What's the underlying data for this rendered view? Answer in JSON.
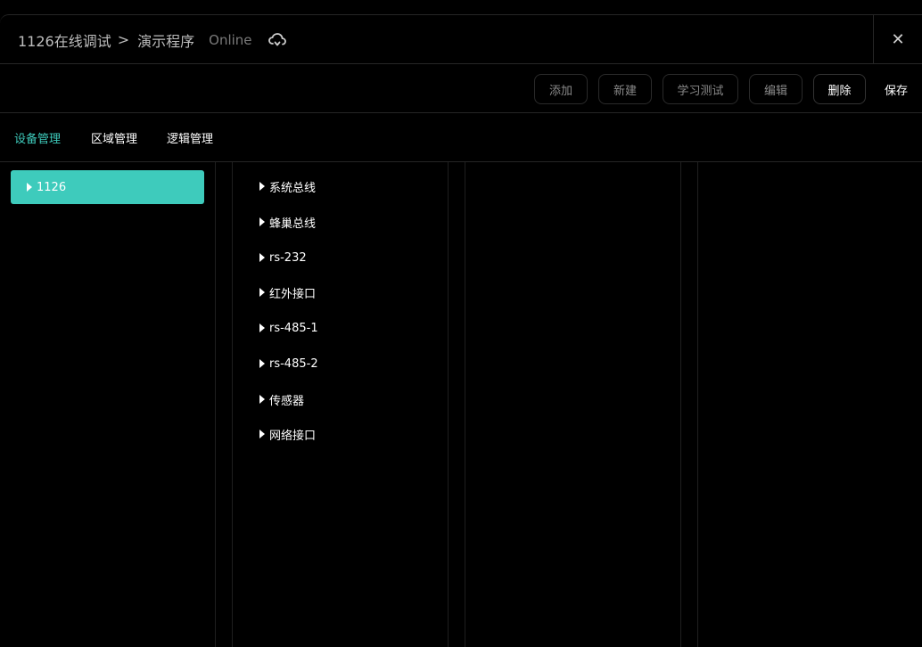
{
  "header": {
    "breadcrumb_project": "1126在线调试",
    "breadcrumb_separator": ">",
    "breadcrumb_current": "演示程序",
    "status": "Online",
    "close_label": "✕"
  },
  "toolbar": {
    "add": "添加",
    "new": "新建",
    "learn_test": "学习测试",
    "edit": "编辑",
    "delete": "删除",
    "save": "保存"
  },
  "tabs": [
    {
      "label": "设备管理",
      "active": true
    },
    {
      "label": "区域管理",
      "active": false
    },
    {
      "label": "逻辑管理",
      "active": false
    }
  ],
  "device_tree": {
    "selected": "1126"
  },
  "interfaces": [
    "系统总线",
    "蜂巢总线",
    "rs-232",
    "红外接口",
    "rs-485-1",
    "rs-485-2",
    "传感器",
    "网络接口"
  ],
  "colors": {
    "accent": "#3ecbbc",
    "background": "#000000",
    "border": "#262626"
  },
  "icons": {
    "status": "cloud-sync-icon",
    "close": "close-icon",
    "expand": "caret-right-icon"
  }
}
